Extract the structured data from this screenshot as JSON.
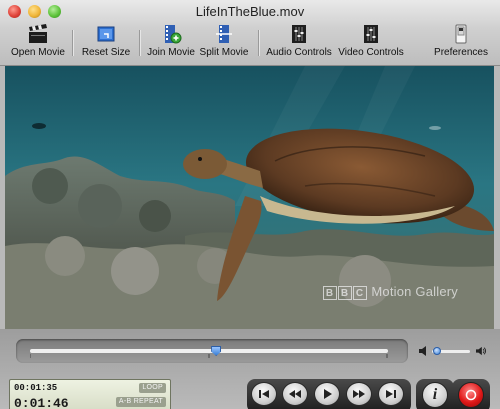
{
  "window": {
    "title": "LifeInTheBlue.mov"
  },
  "toolbar": {
    "items": [
      {
        "label": "Open Movie",
        "icon": "clapperboard-icon"
      },
      {
        "label": "Reset Size",
        "icon": "resize-icon"
      },
      {
        "label": "Join Movie",
        "icon": "film-add-icon"
      },
      {
        "label": "Split Movie",
        "icon": "film-split-icon"
      },
      {
        "label": "Audio Controls",
        "icon": "audio-sliders-icon"
      },
      {
        "label": "Video Controls",
        "icon": "video-sliders-icon"
      },
      {
        "label": "Preferences",
        "icon": "preferences-switch-icon"
      }
    ]
  },
  "video": {
    "watermark_logo": "BBC",
    "watermark_text": "Motion Gallery"
  },
  "playback": {
    "scrub_position": 0.52,
    "volume_level": 0.12
  },
  "lcd": {
    "time_small": "00:01:35",
    "time_big": "0:01:46",
    "loop_label": "LOOP",
    "ab_repeat_label": "A-B REPEAT"
  },
  "transport": {
    "buttons": [
      {
        "icon": "skip-to-start-icon"
      },
      {
        "icon": "rewind-icon"
      },
      {
        "icon": "play-icon"
      },
      {
        "icon": "fast-forward-icon"
      },
      {
        "icon": "skip-to-end-icon"
      }
    ]
  },
  "colors": {
    "record": "#e01818",
    "scrub_thumb": "#3a7fd5",
    "lcd_background": "#e4e9d6"
  }
}
